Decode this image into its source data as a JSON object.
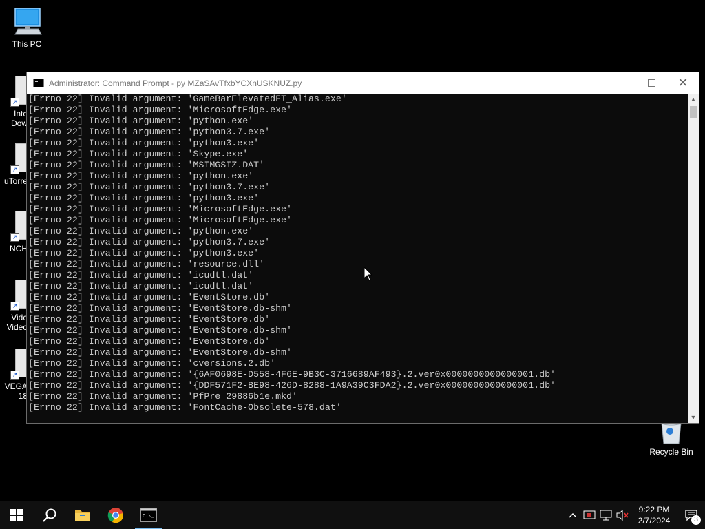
{
  "desktop": {
    "this_pc_label": "This PC",
    "recycle_bin_label": "Recycle Bin",
    "side_icons": [
      {
        "line1": "Inte",
        "line2": "Dow"
      },
      {
        "line1": "uTorre",
        "line2": ""
      },
      {
        "line1": "NCH",
        "line2": ""
      },
      {
        "line1": "Vide",
        "line2": "Video"
      },
      {
        "line1": "VEGA",
        "line2": "18"
      }
    ]
  },
  "window": {
    "title": "Administrator: Command Prompt - py  MZaSAvTfxbYCXnUSKNUZ.py",
    "console_lines": [
      "[Errno 22] Invalid argument: 'GameBarElevatedFT_Alias.exe'",
      "[Errno 22] Invalid argument: 'MicrosoftEdge.exe'",
      "[Errno 22] Invalid argument: 'python.exe'",
      "[Errno 22] Invalid argument: 'python3.7.exe'",
      "[Errno 22] Invalid argument: 'python3.exe'",
      "[Errno 22] Invalid argument: 'Skype.exe'",
      "[Errno 22] Invalid argument: 'MSIMGSIZ.DAT'",
      "[Errno 22] Invalid argument: 'python.exe'",
      "[Errno 22] Invalid argument: 'python3.7.exe'",
      "[Errno 22] Invalid argument: 'python3.exe'",
      "[Errno 22] Invalid argument: 'MicrosoftEdge.exe'",
      "[Errno 22] Invalid argument: 'MicrosoftEdge.exe'",
      "[Errno 22] Invalid argument: 'python.exe'",
      "[Errno 22] Invalid argument: 'python3.7.exe'",
      "[Errno 22] Invalid argument: 'python3.exe'",
      "[Errno 22] Invalid argument: 'resource.dll'",
      "[Errno 22] Invalid argument: 'icudtl.dat'",
      "[Errno 22] Invalid argument: 'icudtl.dat'",
      "[Errno 22] Invalid argument: 'EventStore.db'",
      "[Errno 22] Invalid argument: 'EventStore.db-shm'",
      "[Errno 22] Invalid argument: 'EventStore.db'",
      "[Errno 22] Invalid argument: 'EventStore.db-shm'",
      "[Errno 22] Invalid argument: 'EventStore.db'",
      "[Errno 22] Invalid argument: 'EventStore.db-shm'",
      "[Errno 22] Invalid argument: 'cversions.2.db'",
      "[Errno 22] Invalid argument: '{6AF0698E-D558-4F6E-9B3C-3716689AF493}.2.ver0x0000000000000001.db'",
      "[Errno 22] Invalid argument: '{DDF571F2-BE98-426D-8288-1A9A39C3FDA2}.2.ver0x0000000000000001.db'",
      "[Errno 22] Invalid argument: 'PfPre_29886b1e.mkd'",
      "[Errno 22] Invalid argument: 'FontCache-Obsolete-578.dat'"
    ]
  },
  "taskbar": {
    "apps": [
      "start-icon",
      "search-icon",
      "file-explorer-icon",
      "chrome-icon",
      "command-prompt-icon"
    ],
    "clock_time": "9:22 PM",
    "clock_date": "2/7/2024",
    "notification_count": "3"
  },
  "colors": {
    "console_bg": "#0c0c0c",
    "console_text": "#cccccc",
    "taskbar_bg": "#101010",
    "accent": "#76b9ed"
  }
}
